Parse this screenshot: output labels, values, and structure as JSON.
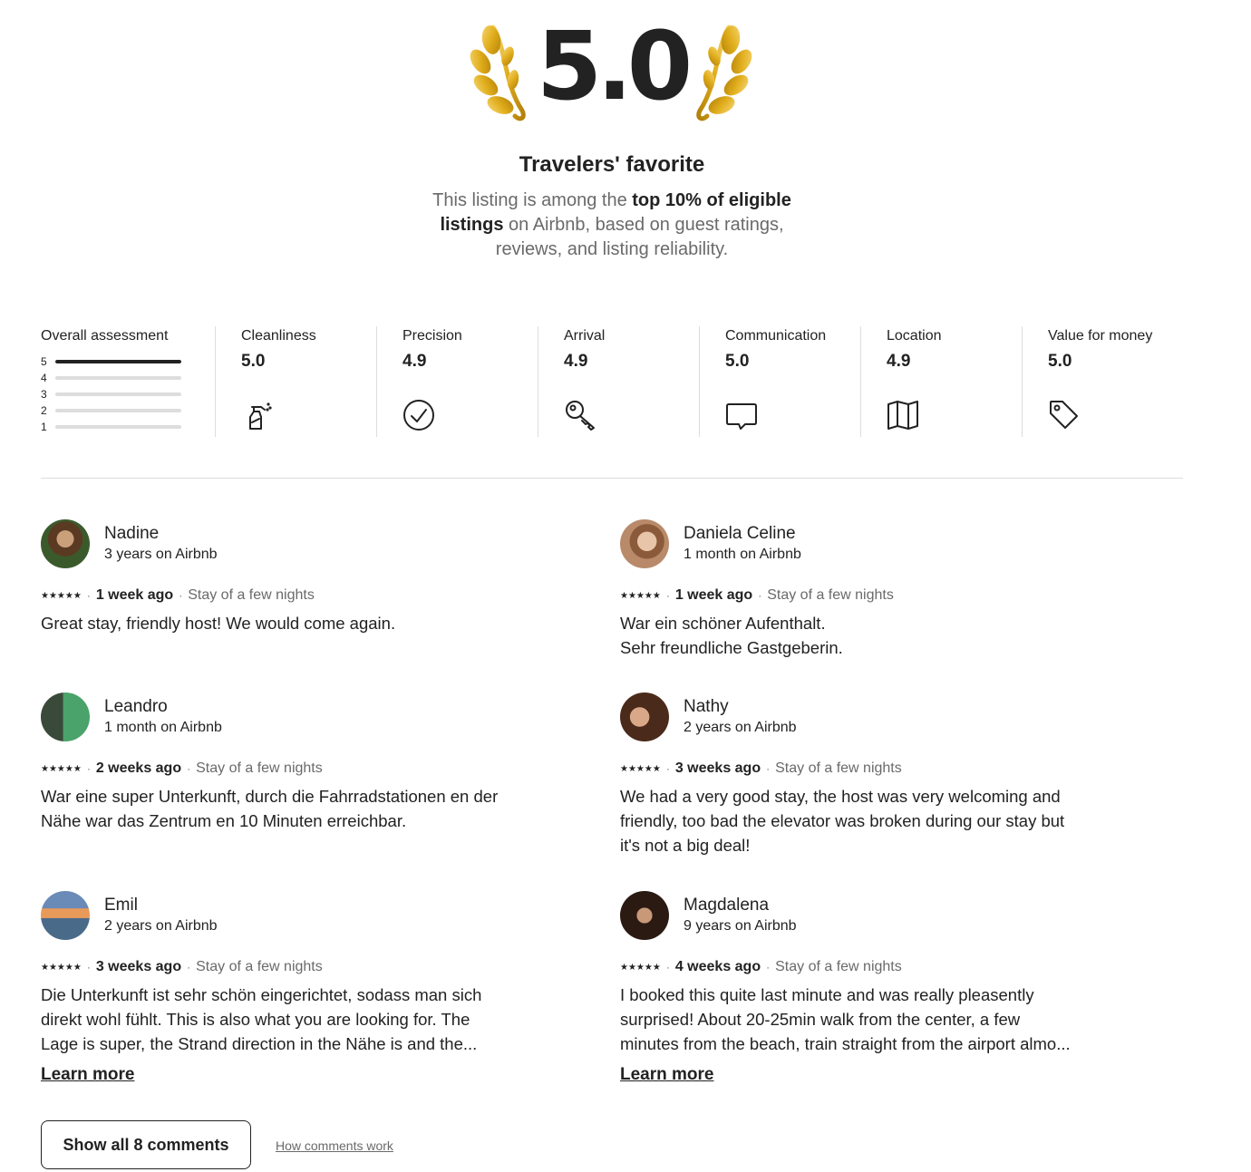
{
  "hero": {
    "score": "5.0",
    "title": "Travelers' favorite",
    "desc_part1": "This listing is among the ",
    "desc_bold": "top 10% of eligible listings",
    "desc_part2": " on Airbnb, based on guest ratings, reviews, and listing reliability."
  },
  "ratings": {
    "overall_label": "Overall assessment",
    "distribution": [
      {
        "stars": "5",
        "fraction": 1.0
      },
      {
        "stars": "4",
        "fraction": 0.0
      },
      {
        "stars": "3",
        "fraction": 0.0
      },
      {
        "stars": "2",
        "fraction": 0.0
      },
      {
        "stars": "1",
        "fraction": 0.0
      }
    ],
    "categories": [
      {
        "label": "Cleanliness",
        "value": "5.0",
        "icon": "spray-bottle-icon"
      },
      {
        "label": "Precision",
        "value": "4.9",
        "icon": "check-circle-icon"
      },
      {
        "label": "Arrival",
        "value": "4.9",
        "icon": "key-icon"
      },
      {
        "label": "Communication",
        "value": "5.0",
        "icon": "chat-bubble-icon"
      },
      {
        "label": "Location",
        "value": "4.9",
        "icon": "map-icon"
      },
      {
        "label": "Value for money",
        "value": "5.0",
        "icon": "price-tag-icon"
      }
    ]
  },
  "reviews": [
    {
      "name": "Nadine",
      "tenure": "3 years on Airbnb",
      "stars": "★★★★★",
      "when": "1 week ago",
      "stay": "Stay of a few nights",
      "text": "Great stay, friendly host! We would come again.",
      "learn_more": ""
    },
    {
      "name": "Daniela Celine",
      "tenure": "1 month on Airbnb",
      "stars": "★★★★★",
      "when": "1 week ago",
      "stay": "Stay of a few nights",
      "text": "War ein schöner Aufenthalt.\nSehr freundliche Gastgeberin.",
      "learn_more": ""
    },
    {
      "name": "Leandro",
      "tenure": "1 month on Airbnb",
      "stars": "★★★★★",
      "when": "2 weeks ago",
      "stay": "Stay of a few nights",
      "text": "War eine super Unterkunft, durch die Fahrradstationen en der\nNähe war das Zentrum en 10 Minuten erreichbar.",
      "learn_more": ""
    },
    {
      "name": "Nathy",
      "tenure": "2 years on Airbnb",
      "stars": "★★★★★",
      "when": "3 weeks ago",
      "stay": "Stay of a few nights",
      "text": "We had a very good stay, the host was very welcoming and\nfriendly, too bad the elevator was broken during our stay but\nit's not a big deal!",
      "learn_more": ""
    },
    {
      "name": "Emil",
      "tenure": "2 years on Airbnb",
      "stars": "★★★★★",
      "when": "3 weeks ago",
      "stay": "Stay of a few nights",
      "text": "Die Unterkunft ist sehr schön eingerichtet, sodass man sich\ndirekt wohl fühlt. This is also what you are looking for. The\nLage is super, the Strand direction in the Nähe is and the...",
      "learn_more": "Learn more"
    },
    {
      "name": "Magdalena",
      "tenure": "9 years on Airbnb",
      "stars": "★★★★★",
      "when": "4 weeks ago",
      "stay": "Stay of a few nights",
      "text": "I booked this quite last minute and was really pleasently\nsurprised! About 20-25min walk from the center, a few\nminutes from the beach, train straight from the airport almo...",
      "learn_more": "Learn more"
    }
  ],
  "footer": {
    "show_all": "Show all 8 comments",
    "how_comments": "How comments work"
  }
}
